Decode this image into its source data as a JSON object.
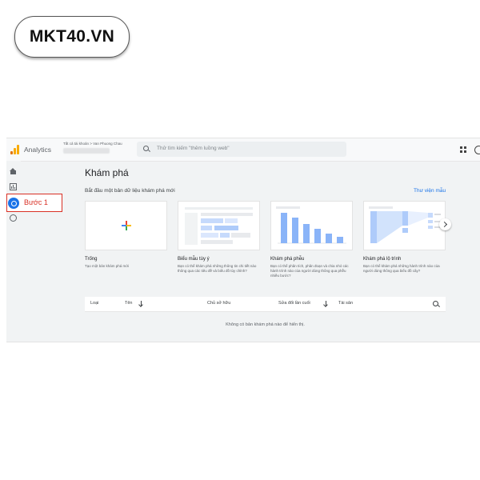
{
  "watermark": "MKT40.VN",
  "app": {
    "name": "Analytics",
    "breadcrumb": "Tất cả tài khoản > Van Phuong Chau",
    "search_placeholder": "Thử tìm kiếm \"thêm luồng web\""
  },
  "annotation": {
    "label": "Bước 1"
  },
  "page": {
    "title": "Khám phá",
    "subtitle": "Bắt đầu một bản dữ liệu khám phá mới",
    "library_link": "Thư viện mẫu"
  },
  "templates": [
    {
      "title": "Trống",
      "desc": "Tạo một bản khám phá mới"
    },
    {
      "title": "Biểu mẫu tùy ý",
      "desc": "Bạn có thể khám phá những thông tin chi tiết nào thông qua các tiêu đề và biểu đồ tùy chỉnh?"
    },
    {
      "title": "Khám phá phễu",
      "desc": "Bạn có thể phân tích, phân đoạn và chia nhỏ các hành trình nào của người dùng thông qua phễu nhiều bước?"
    },
    {
      "title": "Khám phá lộ trình",
      "desc": "Bạn có thể khám phá những hành trình nào của người dùng thông qua biểu đồ cây?"
    }
  ],
  "table": {
    "headers": {
      "type": "Loại",
      "name": "Tên",
      "owner": "Chủ sở hữu",
      "modified": "Sửa đổi lần cuối",
      "property": "Tài sản"
    },
    "empty_text": "Không có bản khám phá nào để hiển thị."
  },
  "colors": {
    "accent": "#1a73e8",
    "annotation": "#d93025",
    "logo": [
      "#f9ab00",
      "#e37400"
    ],
    "plus": [
      "#4285f4",
      "#ea4335",
      "#fbbc04",
      "#34a853"
    ]
  }
}
